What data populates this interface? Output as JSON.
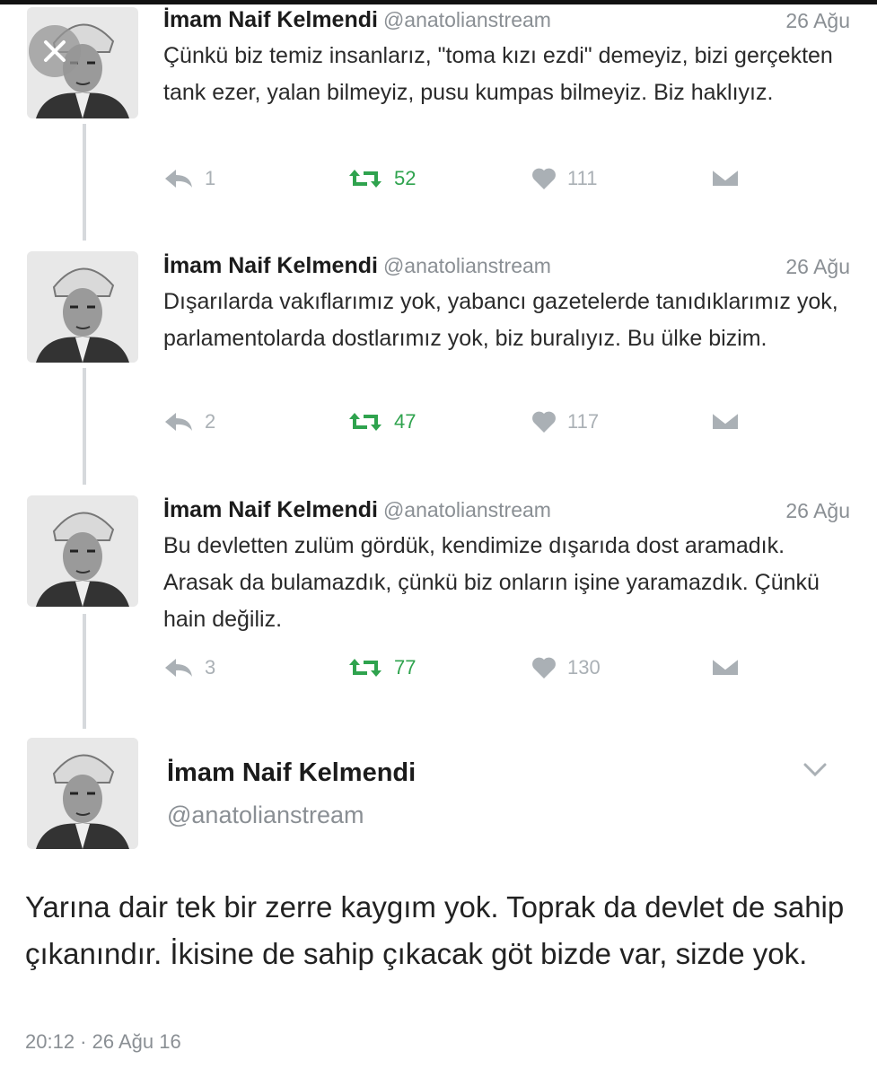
{
  "tweets": [
    {
      "name": "İmam Naif Kelmendi",
      "handle": "@anatolianstream",
      "date": "26 Ağu",
      "text": "Çünkü biz temiz insanlarız, \"toma kızı ezdi\" demeyiz, bizi gerçekten tank ezer, yalan bilmeyiz, pusu kumpas bilmeyiz. Biz haklıyız.",
      "replies": "1",
      "retweets": "52",
      "likes": "111"
    },
    {
      "name": "İmam Naif Kelmendi",
      "handle": "@anatolianstream",
      "date": "26 Ağu",
      "text": "Dışarılarda vakıflarımız yok, yabancı gazetelerde tanıdıklarımız yok, parlamentolarda dostlarımız yok, biz buralıyız. Bu ülke bizim.",
      "replies": "2",
      "retweets": "47",
      "likes": "117"
    },
    {
      "name": "İmam Naif Kelmendi",
      "handle": "@anatolianstream",
      "date": "26 Ağu",
      "text": "Bu devletten zulüm gördük, kendimize dışarıda dost aramadık. Arasak da bulamazdık, çünkü biz onların işine yaramazdık. Çünkü hain değiliz.",
      "replies": "3",
      "retweets": "77",
      "likes": "130"
    }
  ],
  "main_tweet": {
    "name": "İmam Naif Kelmendi",
    "handle": "@anatolianstream",
    "text": "Yarına dair tek bir zerre kaygım yok. Toprak da devlet de sahip çıkanındır. İkisine de sahip çıkacak göt bizde var, sizde yok.",
    "timestamp": "20:12 · 26 Ağu 16"
  },
  "icons": {
    "reply": "reply-icon",
    "retweet": "retweet-icon",
    "like": "heart-icon",
    "dm": "message-icon",
    "close": "close-icon",
    "chevron": "chevron-down-icon"
  },
  "colors": {
    "retweet": "#2fa34e",
    "muted": "#aab0b5",
    "handle": "#8a8f94"
  }
}
